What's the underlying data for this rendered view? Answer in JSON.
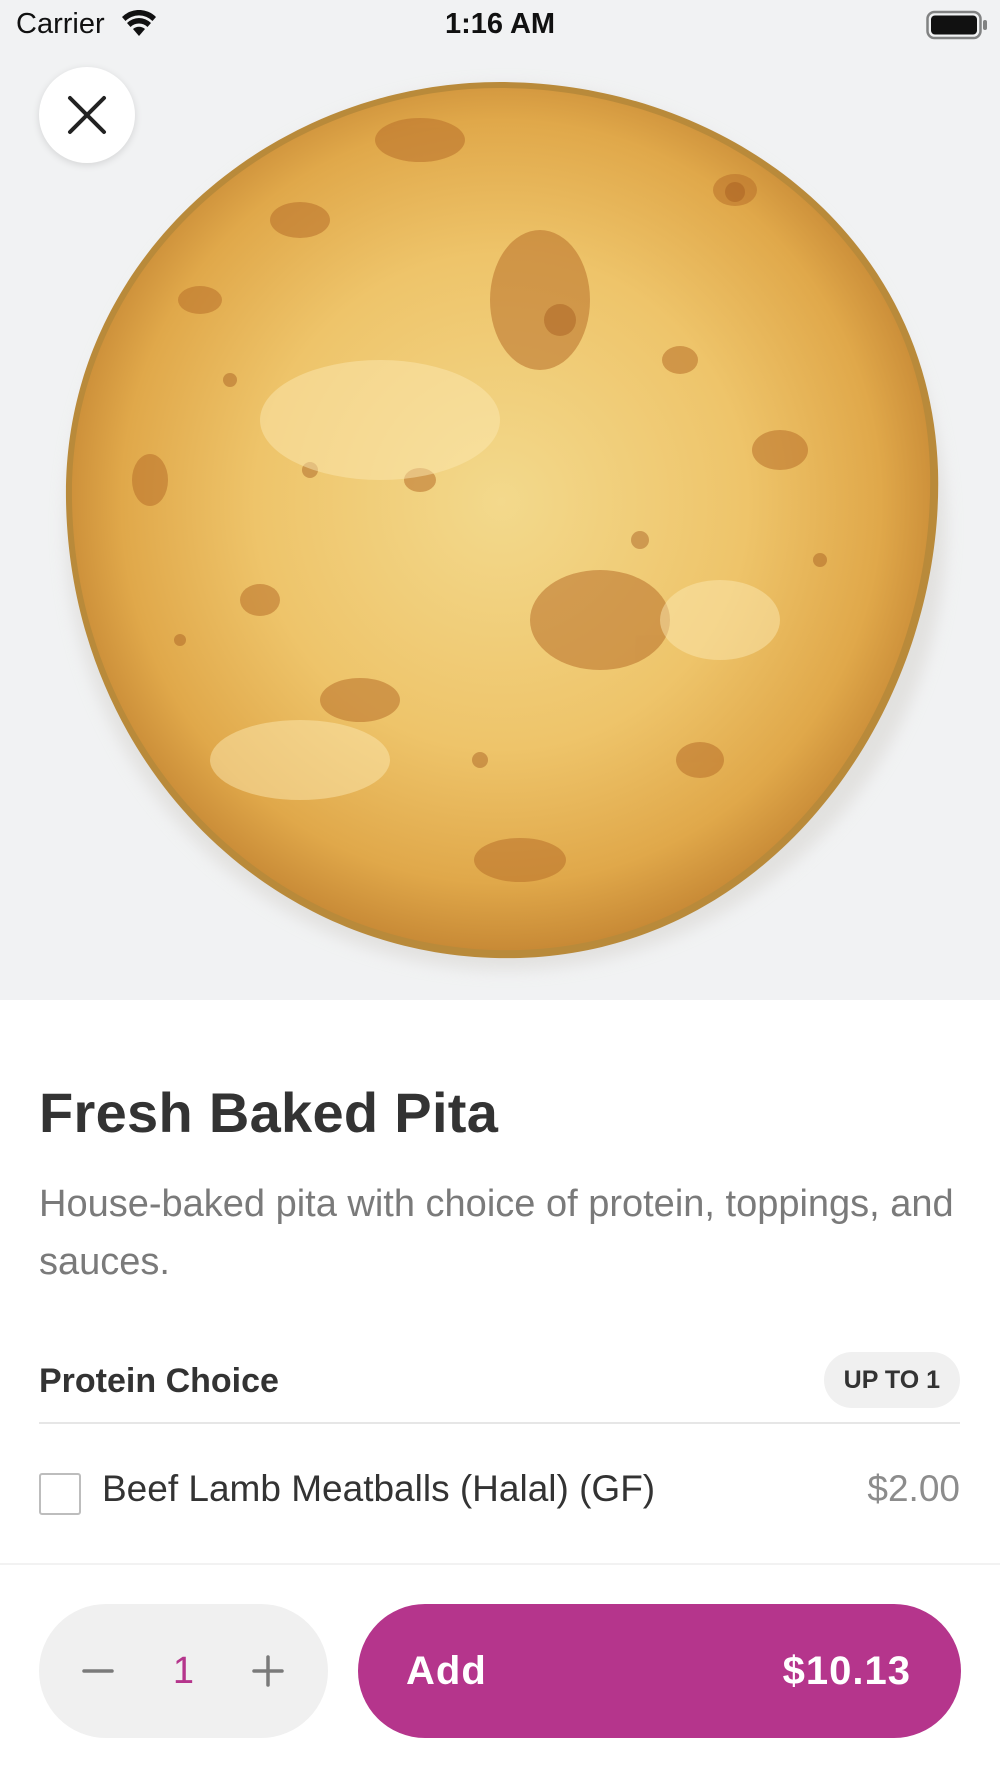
{
  "status_bar": {
    "carrier": "Carrier",
    "time": "1:16 AM",
    "wifi_icon": "wifi-icon",
    "battery_icon": "battery-full-icon"
  },
  "hero": {
    "image": "pita-bread-photo",
    "close_icon": "close-icon"
  },
  "item": {
    "title": "Fresh Baked Pita",
    "description": "House-baked pita with choice of protein, toppings, and sauces."
  },
  "modifier_group": {
    "title": "Protein Choice",
    "limit_badge": "UP TO 1",
    "options": [
      {
        "label": "Beef Lamb Meatballs (Halal) (GF)",
        "price": "$2.00",
        "checked": false
      }
    ]
  },
  "cart": {
    "quantity": "1",
    "decrement_icon": "minus-icon",
    "increment_icon": "plus-icon",
    "add_label": "Add",
    "total": "$10.13"
  },
  "colors": {
    "accent": "#b5358c",
    "hero_background": "#f1f2f3",
    "stepper_background": "#f0f0f0",
    "muted_text": "#7a7a7a"
  }
}
